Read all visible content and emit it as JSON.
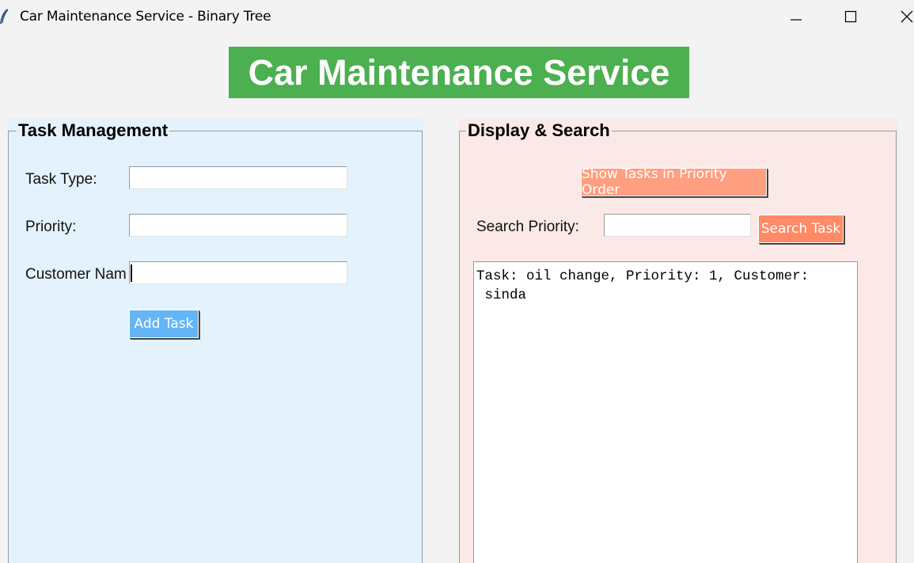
{
  "window": {
    "title": "Car Maintenance Service - Binary Tree",
    "icon": "feather-icon",
    "controls": [
      "minimize-icon",
      "maximize-icon",
      "close-icon"
    ]
  },
  "header": {
    "title": "Car Maintenance Service",
    "bg_color": "#4caf50"
  },
  "task_management": {
    "title": "Task Management",
    "bg_color": "#e3f2fd",
    "task_type_label": "Task Type:",
    "task_type_value": "",
    "priority_label": "Priority:",
    "priority_value": "",
    "customer_label": "Customer Nam",
    "customer_value": "",
    "add_button": "Add Task",
    "add_button_color": "#64b5f6"
  },
  "display_search": {
    "title": "Display & Search",
    "bg_color": "#fbe9e7",
    "show_button": "Show Tasks in Priority Order",
    "show_button_color": "#ff9e80",
    "search_label": "Search Priority:",
    "search_value": "",
    "search_button": "Search Task",
    "search_button_color": "#ff8a65",
    "output": "Task: oil change, Priority: 1, Customer:\n sinda"
  }
}
